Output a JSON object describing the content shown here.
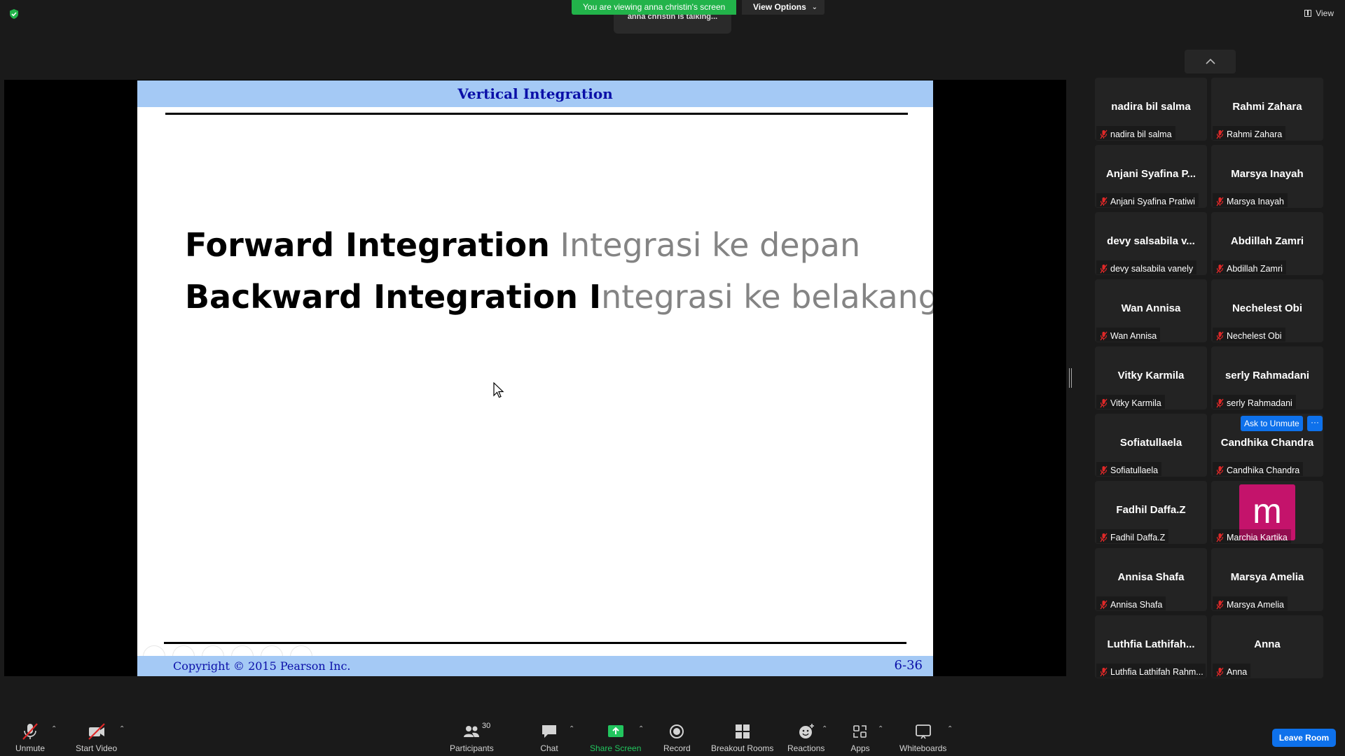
{
  "top_bar": {
    "viewing_banner": "You are viewing anna christin's screen",
    "view_options_label": "View Options",
    "talking_indicator": "anna christin is talking...",
    "view_label": "View"
  },
  "slide": {
    "title": "Vertical Integration",
    "line1_bold": "Forward Integration",
    "line1_translation": " Integrasi ke depan",
    "line2_bold": "Backward Integration I",
    "line2_translation": "ntegrasi ke belakang",
    "copyright": "Copyright © 2015 Pearson Inc.",
    "slide_number": "6-36"
  },
  "participants": [
    {
      "display": "nadira bil salma",
      "label": "nadira bil salma"
    },
    {
      "display": "Rahmi Zahara",
      "label": "Rahmi Zahara"
    },
    {
      "display": "Anjani Syafina P...",
      "label": "Anjani Syafina Pratiwi"
    },
    {
      "display": "Marsya Inayah",
      "label": "Marsya Inayah"
    },
    {
      "display": "devy salsabila v...",
      "label": "devy salsabila vanely"
    },
    {
      "display": "Abdillah Zamri",
      "label": "Abdillah Zamri"
    },
    {
      "display": "Wan Annisa",
      "label": "Wan Annisa"
    },
    {
      "display": "Nechelest Obi",
      "label": "Nechelest Obi"
    },
    {
      "display": "Vitky Karmila",
      "label": "Vitky Karmila"
    },
    {
      "display": "serly Rahmadani",
      "label": "serly Rahmadani"
    },
    {
      "display": "Sofiatullaela",
      "label": "Sofiatullaela"
    },
    {
      "display": "Candhika Chandra",
      "label": "Candhika Chandra"
    },
    {
      "display": "Fadhil Daffa.Z",
      "label": "Fadhil Daffa.Z"
    },
    {
      "display": "",
      "label": "Marchia Kartika",
      "avatar_letter": "m",
      "avatar_color": "#c4136b"
    },
    {
      "display": "Annisa Shafa",
      "label": "Annisa Shafa"
    },
    {
      "display": "Marsya Amelia",
      "label": "Marsya Amelia"
    },
    {
      "display": "Luthfia Lathifah...",
      "label": "Luthfia Lathifah Rahm..."
    },
    {
      "display": "Anna",
      "label": "Anna"
    }
  ],
  "hover_actions": {
    "ask_to_unmute": "Ask to Unmute",
    "more": "···"
  },
  "toolbar": {
    "unmute": "Unmute",
    "start_video": "Start Video",
    "participants": "Participants",
    "participants_count": "30",
    "chat": "Chat",
    "share_screen": "Share Screen",
    "record": "Record",
    "breakout_rooms": "Breakout Rooms",
    "reactions": "Reactions",
    "apps": "Apps",
    "whiteboards": "Whiteboards",
    "leave_room": "Leave Room"
  },
  "colors": {
    "slide_header": "#a4c9f5",
    "slide_title": "#0a0fa8",
    "banner_green": "#22b34a",
    "accent_blue": "#0e71eb",
    "muted_red": "#e02828"
  }
}
